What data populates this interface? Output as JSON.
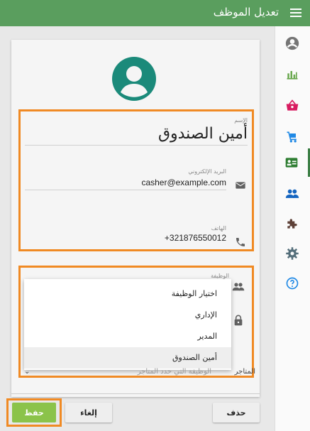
{
  "appbar": {
    "title": "تعديل الموظف",
    "menu_icon": "menu-icon"
  },
  "sidebar": {
    "items": [
      {
        "icon": "account-circle-icon"
      },
      {
        "icon": "bar-chart-icon"
      },
      {
        "icon": "basket-icon"
      },
      {
        "icon": "cart-icon"
      },
      {
        "icon": "id-card-icon",
        "active": true
      },
      {
        "icon": "people-icon"
      },
      {
        "icon": "puzzle-icon"
      },
      {
        "icon": "gear-icon"
      },
      {
        "icon": "help-icon"
      }
    ]
  },
  "form": {
    "name_label": "الإسم",
    "name_value": "أمين الصندوق",
    "email_label": "البريد الإلكتروني",
    "email_value": "casher@example.com",
    "phone_label": "الهاتف",
    "phone_value": "+321876550012",
    "role_label": "الوظيفة",
    "role_options": [
      "اختيار الوظيفة",
      "الإداري",
      "المدير",
      "أمين الصندوق"
    ],
    "role_selected": "أمين الصندوق",
    "store_label": "المتاجر",
    "store_value": "الوظيفة التي حدد المتاجر"
  },
  "actions": {
    "save": "حفظ",
    "cancel": "إلغاء",
    "delete": "حذف"
  },
  "colors": {
    "appbar": "#5a9e5e",
    "accent": "#3a7d44",
    "save": "#8bc34a",
    "highlight": "#f08a24"
  }
}
